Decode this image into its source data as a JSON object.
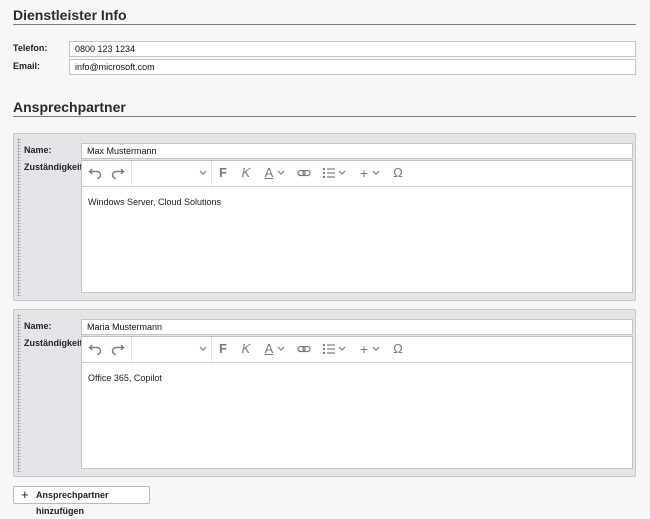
{
  "provider": {
    "title": "Dienstleister Info",
    "phone_label": "Telefon:",
    "phone_value": "0800 123 1234",
    "email_label": "Email:",
    "email_value": "info@microsoft.com"
  },
  "contacts": {
    "title": "Ansprechpartner",
    "items": [
      {
        "name_label": "Name:",
        "name_value": "Max Mustermann",
        "responsibility_label": "Zuständigkeit:",
        "responsibility_text": "Windows Server, Cloud Solutions"
      },
      {
        "name_label": "Name:",
        "name_value": "Maria Mustermann",
        "responsibility_label": "Zuständigkeit:",
        "responsibility_text": "Office 365, Copilot"
      }
    ],
    "add_button": "Ansprechpartner hinzufügen"
  },
  "toolbar": {
    "bold": "F",
    "italic": "K",
    "font_color": "A",
    "special_chars": "Ω",
    "insert": "+"
  },
  "icons": [
    "undo-icon",
    "redo-icon",
    "chevron-down-icon",
    "link-icon",
    "list-icon",
    "plus-icon",
    "omega-icon",
    "drag-handle-icon"
  ]
}
